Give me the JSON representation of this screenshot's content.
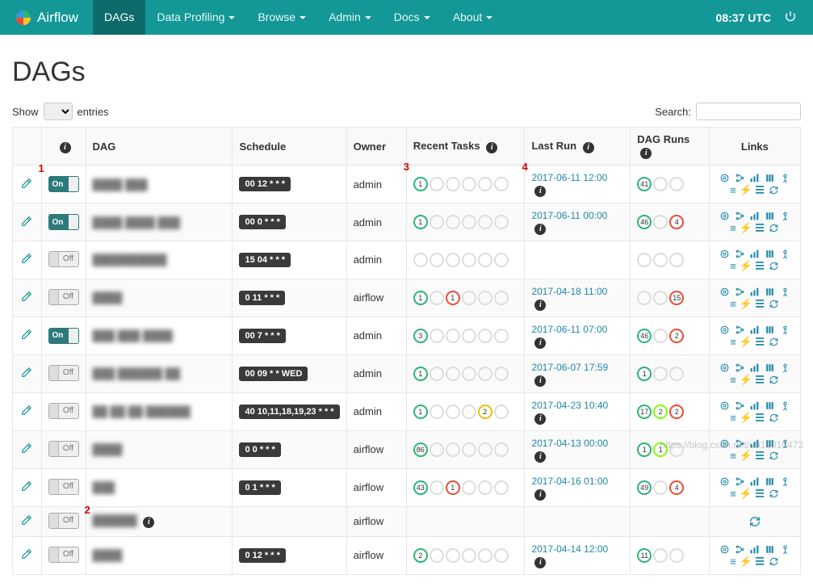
{
  "nav": {
    "brand": "Airflow",
    "items": [
      "DAGs",
      "Data Profiling",
      "Browse",
      "Admin",
      "Docs",
      "About"
    ],
    "active_index": 0,
    "time": "08:37 UTC"
  },
  "page": {
    "title": "DAGs"
  },
  "controls": {
    "show_label": "Show",
    "entries_label": "entries",
    "search_label": "Search:",
    "search_placeholder": ""
  },
  "columns": {
    "info": "",
    "dag": "DAG",
    "schedule": "Schedule",
    "owner": "Owner",
    "recent": "Recent Tasks",
    "lastrun": "Last Run",
    "dagruns": "DAG Runs",
    "links": "Links"
  },
  "annotations": {
    "a1": "1",
    "a2": "2",
    "a3": "3",
    "a4": "4"
  },
  "watermark": "https://blog.csdn.net/u013010473",
  "rows": [
    {
      "on": true,
      "dag": "████ ███",
      "sched": "00 12 * * *",
      "owner": "admin",
      "recent": [
        {
          "v": "1",
          "c": "green"
        }
      ],
      "recent_pad": 5,
      "lastrun": "2017-06-11 12:00",
      "runs": [
        {
          "v": "41",
          "c": "green"
        }
      ],
      "runs_pad": 2,
      "links": "full"
    },
    {
      "on": true,
      "dag": "████ ████ ███",
      "sched": "00 0 * * *",
      "owner": "admin",
      "recent": [
        {
          "v": "1",
          "c": "green"
        }
      ],
      "recent_pad": 5,
      "lastrun": "2017-06-11 00:00",
      "runs": [
        {
          "v": "46",
          "c": "green"
        },
        {
          "v": "",
          "c": "empty"
        },
        {
          "v": "4",
          "c": "red"
        }
      ],
      "runs_pad": 0,
      "links": "full"
    },
    {
      "on": false,
      "dag": "██████████",
      "sched": "15 04 * * *",
      "owner": "admin",
      "recent": [],
      "recent_pad": 6,
      "lastrun": "",
      "runs": [],
      "runs_pad": 3,
      "links": "full"
    },
    {
      "on": false,
      "dag": "████",
      "sched": "0 11 * * *",
      "owner": "airflow",
      "recent": [
        {
          "v": "1",
          "c": "green"
        },
        {
          "v": "",
          "c": "empty"
        },
        {
          "v": "1",
          "c": "red"
        }
      ],
      "recent_pad": 3,
      "lastrun": "2017-04-18 11:00",
      "runs": [
        {
          "v": "",
          "c": "empty"
        },
        {
          "v": "",
          "c": "empty"
        },
        {
          "v": "15",
          "c": "red"
        }
      ],
      "runs_pad": 0,
      "links": "full"
    },
    {
      "on": true,
      "dag": "███ ███ ████",
      "sched": "00 7 * * *",
      "owner": "admin",
      "recent": [
        {
          "v": "3",
          "c": "green"
        }
      ],
      "recent_pad": 5,
      "lastrun": "2017-06-11 07:00",
      "runs": [
        {
          "v": "46",
          "c": "green"
        },
        {
          "v": "",
          "c": "empty"
        },
        {
          "v": "2",
          "c": "red"
        }
      ],
      "runs_pad": 0,
      "links": "full"
    },
    {
      "on": false,
      "dag": "███ ██████ ██",
      "sched": "00 09 * * WED",
      "owner": "admin",
      "recent": [
        {
          "v": "1",
          "c": "green"
        }
      ],
      "recent_pad": 5,
      "lastrun": "2017-06-07 17:59",
      "runs": [
        {
          "v": "1",
          "c": "green"
        }
      ],
      "runs_pad": 2,
      "links": "full"
    },
    {
      "on": false,
      "dag": "██ ██ ██ ██████",
      "sched": "40 10,11,18,19,23 * * *",
      "owner": "admin",
      "recent": [
        {
          "v": "1",
          "c": "green"
        },
        {
          "v": "",
          "c": "empty"
        },
        {
          "v": "",
          "c": "empty"
        },
        {
          "v": "",
          "c": "empty"
        },
        {
          "v": "2",
          "c": "yellow"
        }
      ],
      "recent_pad": 1,
      "lastrun": "2017-04-23 10:40",
      "runs": [
        {
          "v": "17",
          "c": "green"
        },
        {
          "v": "2",
          "c": "lime"
        },
        {
          "v": "2",
          "c": "red"
        }
      ],
      "runs_pad": 0,
      "links": "full"
    },
    {
      "on": false,
      "dag": "████",
      "sched": "0 0 * * *",
      "owner": "airflow",
      "recent": [
        {
          "v": "86",
          "c": "green"
        }
      ],
      "recent_pad": 5,
      "lastrun": "2017-04-13 00:00",
      "runs": [
        {
          "v": "1",
          "c": "green"
        },
        {
          "v": "1",
          "c": "lime"
        }
      ],
      "runs_pad": 1,
      "links": "full"
    },
    {
      "on": false,
      "dag": "███",
      "sched": "0 1 * * *",
      "owner": "airflow",
      "recent": [
        {
          "v": "43",
          "c": "green"
        },
        {
          "v": "",
          "c": "empty"
        },
        {
          "v": "1",
          "c": "red"
        }
      ],
      "recent_pad": 3,
      "lastrun": "2017-04-16 01:00",
      "runs": [
        {
          "v": "49",
          "c": "green"
        },
        {
          "v": "",
          "c": "empty"
        },
        {
          "v": "4",
          "c": "red"
        }
      ],
      "runs_pad": 0,
      "links": "full"
    },
    {
      "on": false,
      "dag": "██████",
      "sched": "",
      "owner": "airflow",
      "recent": [],
      "recent_pad": 0,
      "lastrun": "",
      "runs": [],
      "runs_pad": 0,
      "links": "refresh"
    },
    {
      "on": false,
      "dag": "████",
      "sched": "0 12 * * *",
      "owner": "airflow",
      "recent": [
        {
          "v": "2",
          "c": "green"
        }
      ],
      "recent_pad": 5,
      "lastrun": "2017-04-14 12:00",
      "runs": [
        {
          "v": "11",
          "c": "green"
        }
      ],
      "runs_pad": 2,
      "links": "full"
    }
  ]
}
